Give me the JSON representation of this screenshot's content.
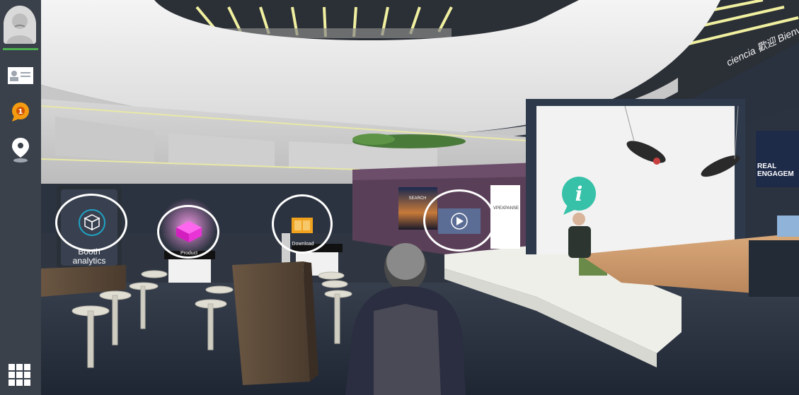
{
  "sidebar": {
    "items": [
      {
        "name": "profile-avatar"
      },
      {
        "name": "business-card-icon"
      },
      {
        "name": "notification-icon",
        "badge": "1"
      },
      {
        "name": "location-pin-icon"
      },
      {
        "name": "apps-grid-icon"
      }
    ],
    "colors": {
      "bg": "#3a414b",
      "accent": "#4caf50",
      "badge": "#f39c12"
    }
  },
  "scene": {
    "booth_label": "Booth analytics",
    "booth_label_line1": "Booth",
    "booth_label_line2": "analytics",
    "product_label": "Product",
    "document_label": "Download",
    "screen_search_label": "SEARCH",
    "screen_brand": "VPEXPANSE",
    "welcome_text": "ciencia 歡迎 Bienv",
    "signage_line1": "REAL",
    "signage_line2": "ENGAGEM"
  },
  "hotspots": [
    {
      "name": "booth-analytics-hotspot",
      "icon": "cube-icon"
    },
    {
      "name": "product-hotspot",
      "icon": "product-box-icon"
    },
    {
      "name": "document-hotspot",
      "icon": "document-icon"
    },
    {
      "name": "video-hotspot",
      "icon": "play-icon"
    },
    {
      "name": "info-hotspot",
      "icon": "info-icon"
    }
  ]
}
